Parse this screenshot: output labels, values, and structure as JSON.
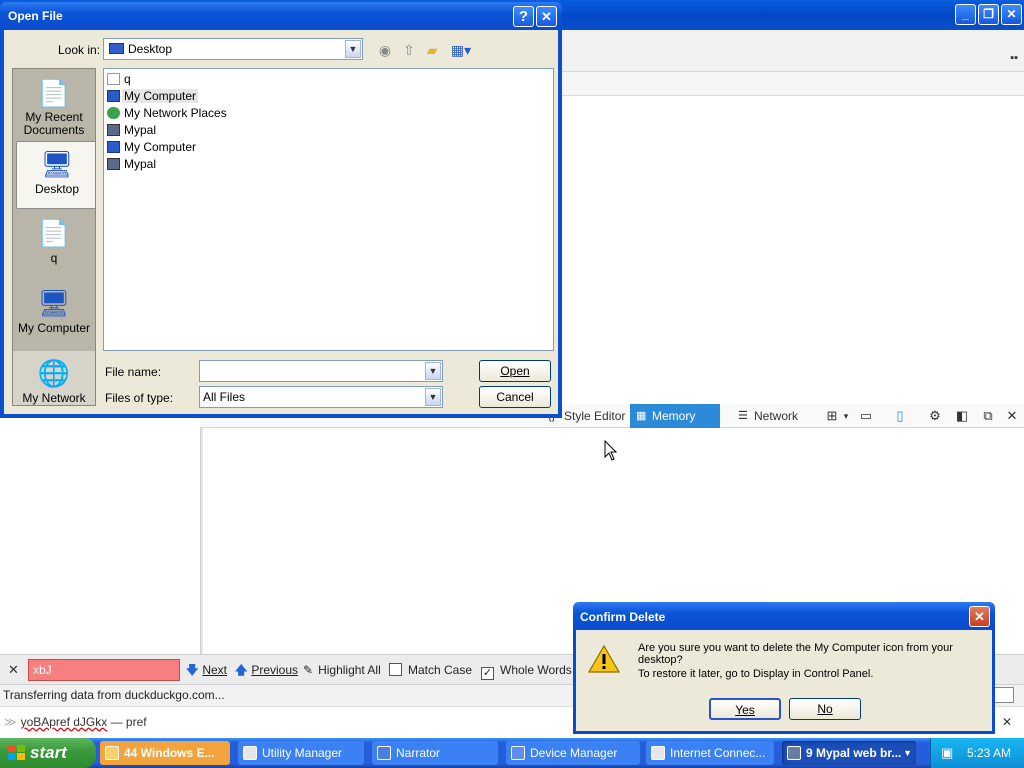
{
  "bg": {
    "devtools_tabs": [
      {
        "label": "Style Editor",
        "icon": "style-editor-icon"
      },
      {
        "label": "Memory",
        "icon": "memory-icon"
      },
      {
        "label": "Network",
        "icon": "network-icon"
      }
    ]
  },
  "findbar": {
    "query": "xbJ",
    "next_label": "Next",
    "previous_label": "Previous",
    "highlight_label": "Highlight All",
    "match_case_label": "Match Case",
    "whole_words_label": "Whole Words",
    "match_case_checked": false,
    "whole_words_checked": true
  },
  "status": {
    "text": "Transferring data from duckduckgo.com..."
  },
  "urlbar": {
    "typed": "yoBApref dJGkx",
    "suggestion": " — pref"
  },
  "open_dialog": {
    "title": "Open File",
    "help_label": "?",
    "close_label": "✕",
    "lookin_label": "Look in:",
    "lookin_value": "Desktop",
    "places": [
      {
        "label": "My Recent Documents",
        "icon": "recent-documents-icon"
      },
      {
        "label": "Desktop",
        "icon": "desktop-icon"
      },
      {
        "label": "q",
        "icon": "user-documents-icon"
      },
      {
        "label": "My Computer",
        "icon": "my-computer-icon"
      },
      {
        "label": "My Network",
        "icon": "my-network-icon"
      }
    ],
    "files": [
      {
        "label": "q",
        "icon": "document-icon"
      },
      {
        "label": "My Computer",
        "icon": "my-computer-icon"
      },
      {
        "label": "My Network Places",
        "icon": "network-places-icon"
      },
      {
        "label": "Mypal",
        "icon": "mypal-icon"
      },
      {
        "label": "My Computer",
        "icon": "my-computer-icon"
      },
      {
        "label": "Mypal",
        "icon": "mypal-icon"
      }
    ],
    "filename_label": "File name:",
    "filename_value": "",
    "filetype_label": "Files of type:",
    "filetype_value": "All Files",
    "open_button": "Open",
    "cancel_button": "Cancel"
  },
  "confirm_dialog": {
    "title": "Confirm Delete",
    "message": "Are you sure you want to delete the My Computer icon from your desktop?",
    "hint": "To restore it later, go to Display in Control Panel.",
    "yes": "Yes",
    "no": "No"
  },
  "taskbar": {
    "start_label": "start",
    "buttons": [
      {
        "label": "44 Windows E...",
        "active": false
      },
      {
        "label": "Utility Manager",
        "active": false
      },
      {
        "label": "Narrator",
        "active": false
      },
      {
        "label": "Device Manager",
        "active": false
      },
      {
        "label": "Internet Connec...",
        "active": false
      },
      {
        "label": "9 Mypal web br...",
        "active": true
      }
    ],
    "clock": "5:23 AM"
  }
}
